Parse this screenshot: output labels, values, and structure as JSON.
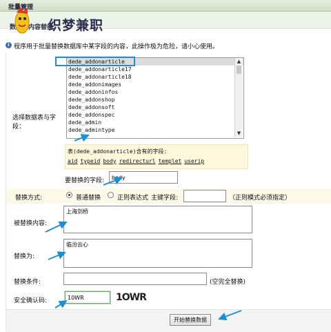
{
  "header": {
    "title": "批量管理",
    "subtitle": "数据库内容替换",
    "watermark": "织梦兼职"
  },
  "notice": "程序用于批量替换数据库中某字段的内容，此操作极为危险，请小心使用。",
  "table_select": {
    "label": "选择数据表与字段：",
    "items": [
      "dede_addonarticle",
      "dede_addonarticle17",
      "dede_addonarticle18",
      "dede_addonimages",
      "dede_addoninfos",
      "dede_addonshop",
      "dede_addonsoft",
      "dede_addonspec",
      "dede_admin",
      "dede_admintype"
    ],
    "selected": "dede_addonarticle"
  },
  "fields_box": {
    "title": "表(dede_addonarticle)含有的字段:",
    "fields": [
      "aid",
      "typeid",
      "body",
      "redirecturl",
      "templet",
      "userip"
    ]
  },
  "replace_field": {
    "label": "要替换的字段:",
    "value": "body"
  },
  "replace_mode": {
    "label": "替换方式:",
    "option_normal": "普通替换",
    "option_regex": "正则表达式",
    "key_field_label": "主键字段:",
    "key_field_value": "",
    "regex_note": "（正则模式必须指定）"
  },
  "replaced_content": {
    "label": "被替换内容:",
    "value": "上海剑桥"
  },
  "replace_with": {
    "label": "替换为:",
    "value": "临汾云心"
  },
  "condition": {
    "label": "替换条件:",
    "value": "",
    "note": "(空完全替换)"
  },
  "captcha": {
    "label": "安全确认码:",
    "value": "10WR",
    "image_text": "1OWR"
  },
  "submit": {
    "label": "开始替换数据"
  },
  "colors": {
    "arrow": "#1a8fd8",
    "highlight_row": "#fcf9e8",
    "field_box": "#fdf8dc",
    "title_bar": "#d6e2cc"
  }
}
